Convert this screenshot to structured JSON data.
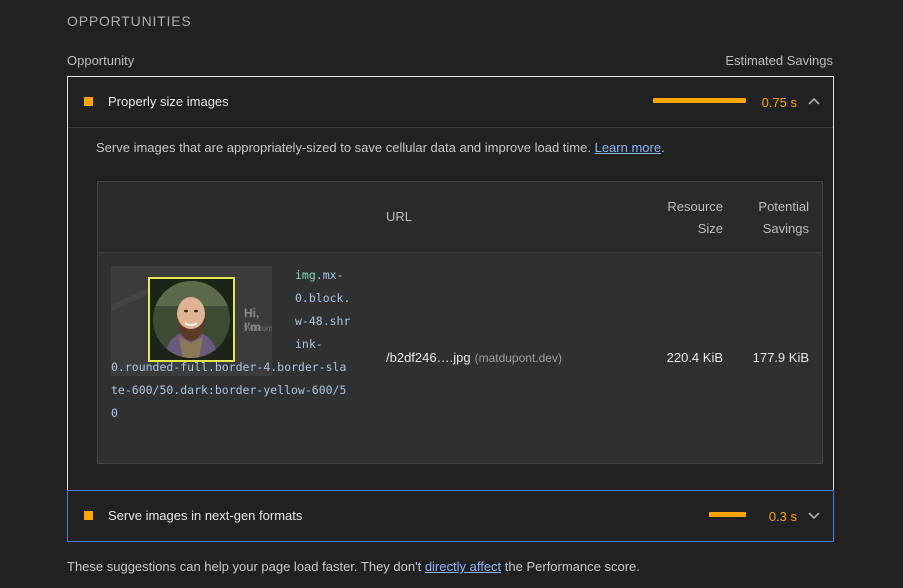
{
  "section_title": "OPPORTUNITIES",
  "columns": {
    "left": "Opportunity",
    "right": "Estimated Savings"
  },
  "colors": {
    "accent": "#ffa400",
    "link": "#8ab4f8",
    "focus_border": "#4e7bd9"
  },
  "audits": [
    {
      "title": "Properly size images",
      "value": "0.75 s",
      "savings_fraction": 1.0,
      "expanded": true,
      "chevron": "chevron-up-icon",
      "description_text": "Serve images that are appropriately-sized to save cellular data and improve load time. ",
      "learn_more": "Learn more",
      "description_end": ".",
      "table": {
        "headers": {
          "url": "URL",
          "resource_size": "Resource Size",
          "potential_savings": "Potential Savings"
        },
        "rows": [
          {
            "node_tag": "img",
            "node_first": ".mx-0.block.w-48.shrink-",
            "node_rest": "0.rounded-full.border-4.border-slate-600/50.dark:border-yellow-600/50",
            "thumb_text_1": "Hi, I'm",
            "thumb_text_2": "Welcome",
            "url": "/b2df246….jpg",
            "host": "(matdupont.dev)",
            "resource_size": "220.4 KiB",
            "potential_savings": "177.9 KiB"
          }
        ]
      }
    },
    {
      "title": "Serve images in next-gen formats",
      "value": "0.3 s",
      "savings_fraction": 0.4,
      "expanded": false,
      "chevron": "chevron-down-icon"
    }
  ],
  "footer": {
    "before": "These suggestions can help your page load faster. They don't ",
    "link": "directly affect",
    "after": " the Performance score."
  }
}
